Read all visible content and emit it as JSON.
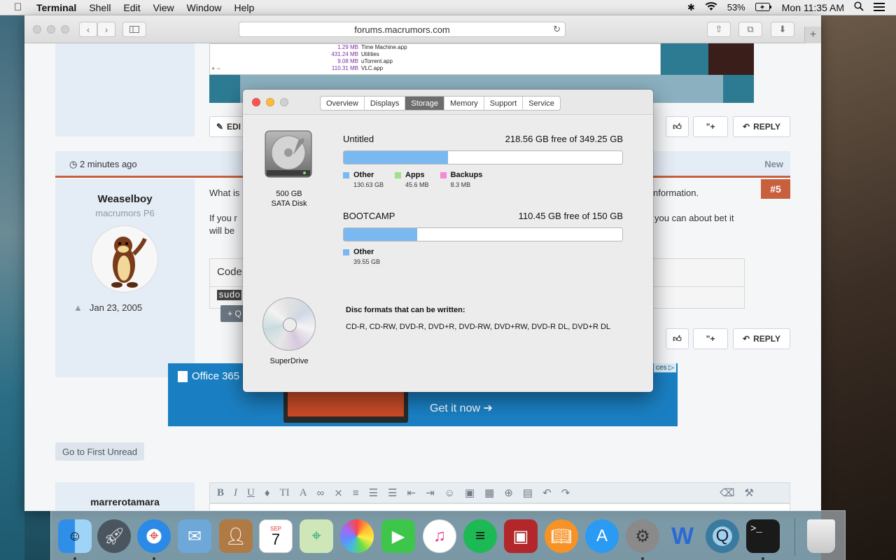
{
  "menubar": {
    "app_name": "Terminal",
    "items": [
      "Shell",
      "Edit",
      "View",
      "Window",
      "Help"
    ],
    "battery": "53%",
    "clock": "Mon 11:35 AM"
  },
  "safari": {
    "url": "forums.macrumors.com"
  },
  "forum": {
    "embed_files": [
      {
        "size": "1.29 MB",
        "name": "Time Machine.app"
      },
      {
        "size": "431.24 MB",
        "name": "Utilities"
      },
      {
        "size": "9.08 MB",
        "name": "uTorrent.app"
      },
      {
        "size": "110.31 MB",
        "name": "VLC.app"
      }
    ],
    "edit_label": "EDI",
    "reply_label": "REPLY",
    "post_time": "2 minutes ago",
    "new_label": "New",
    "post_number": "#5",
    "username": "Weaselboy",
    "user_title": "macrumors P6",
    "joined": "Jan 23, 2005",
    "text_line1_start": "What is",
    "text_line1_end": "nformation.",
    "text_line2_start": "If you r",
    "text_line2_end": "you can about bet it",
    "text_line3_start": "will be",
    "code_header": "Code",
    "code_line": "sudo",
    "quote_label": "+ Q",
    "first_unread": "Go to First Unread",
    "editor_user": "marrerotamara",
    "ad": {
      "brand": "Office 365",
      "cta": "Get it now",
      "adchoices": "ces"
    }
  },
  "sysinfo": {
    "tabs": [
      "Overview",
      "Displays",
      "Storage",
      "Memory",
      "Support",
      "Service"
    ],
    "active_tab": "Storage",
    "drive": {
      "capacity": "500 GB",
      "type": "SATA Disk"
    },
    "volumes": [
      {
        "name": "Untitled",
        "free": "218.56 GB free of 349.25 GB",
        "segments": [
          {
            "label": "Other",
            "size": "130.63 GB",
            "color": "#7ab8f0",
            "fraction": 0.374
          },
          {
            "label": "Apps",
            "size": "45.6 MB",
            "color": "#a0e08a",
            "fraction": 0.0
          },
          {
            "label": "Backups",
            "size": "8.3 MB",
            "color": "#f68ad8",
            "fraction": 0.0
          }
        ]
      },
      {
        "name": "BOOTCAMP",
        "free": "110.45 GB free of 150 GB",
        "segments": [
          {
            "label": "Other",
            "size": "39.55 GB",
            "color": "#7ab8f0",
            "fraction": 0.264
          }
        ]
      }
    ],
    "optical": {
      "name": "SuperDrive",
      "disc_title": "Disc formats that can be written:",
      "disc_formats": "CD-R, CD-RW, DVD-R, DVD+R, DVD-RW, DVD+RW, DVD-R DL, DVD+R DL"
    }
  },
  "dock": {
    "apps": [
      {
        "name": "Finder",
        "icon": "finder-icon",
        "running": true
      },
      {
        "name": "Launchpad",
        "icon": "launchpad-icon",
        "running": false
      },
      {
        "name": "Safari",
        "icon": "safari-icon",
        "running": true
      },
      {
        "name": "Mail",
        "icon": "mail-icon",
        "running": false
      },
      {
        "name": "Contacts",
        "icon": "contacts-icon",
        "running": false
      },
      {
        "name": "Calendar",
        "icon": "calendar-icon",
        "running": false
      },
      {
        "name": "Maps",
        "icon": "maps-icon",
        "running": false
      },
      {
        "name": "Photos",
        "icon": "photos-icon",
        "running": false
      },
      {
        "name": "FaceTime",
        "icon": "facetime-icon",
        "running": false
      },
      {
        "name": "iTunes",
        "icon": "itunes-icon",
        "running": false
      },
      {
        "name": "Spotify",
        "icon": "spotify-icon",
        "running": false
      },
      {
        "name": "Photo Booth",
        "icon": "photobooth-icon",
        "running": false
      },
      {
        "name": "iBooks",
        "icon": "ibooks-icon",
        "running": false
      },
      {
        "name": "App Store",
        "icon": "appstore-icon",
        "running": false
      },
      {
        "name": "System Preferences",
        "icon": "system-preferences-icon",
        "running": true
      },
      {
        "name": "Word",
        "icon": "word-icon",
        "running": false
      },
      {
        "name": "QuickTime",
        "icon": "quicktime-icon",
        "running": false
      },
      {
        "name": "Terminal",
        "icon": "terminal-icon",
        "running": true
      },
      {
        "name": "Trash",
        "icon": "trash-icon",
        "running": false
      }
    ],
    "calendar_month": "SEP",
    "calendar_day": "7"
  }
}
